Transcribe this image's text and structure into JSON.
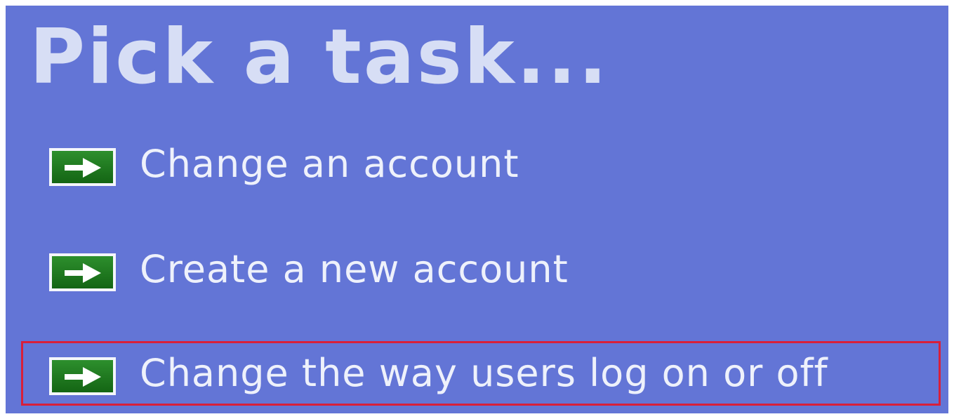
{
  "title": "Pick a task...",
  "tasks": [
    {
      "label": "Change an account",
      "icon": "green-arrow-icon",
      "highlighted": false
    },
    {
      "label": "Create a new account",
      "icon": "green-arrow-icon",
      "highlighted": false
    },
    {
      "label": "Change the way users log on or off",
      "icon": "green-arrow-icon",
      "highlighted": true
    }
  ],
  "colors": {
    "panel_background": "#6375d6",
    "title_text": "#d7def5",
    "task_text": "#eef1fb",
    "arrow_button": "#1f7a1f",
    "highlight_border": "#d81f3a"
  }
}
